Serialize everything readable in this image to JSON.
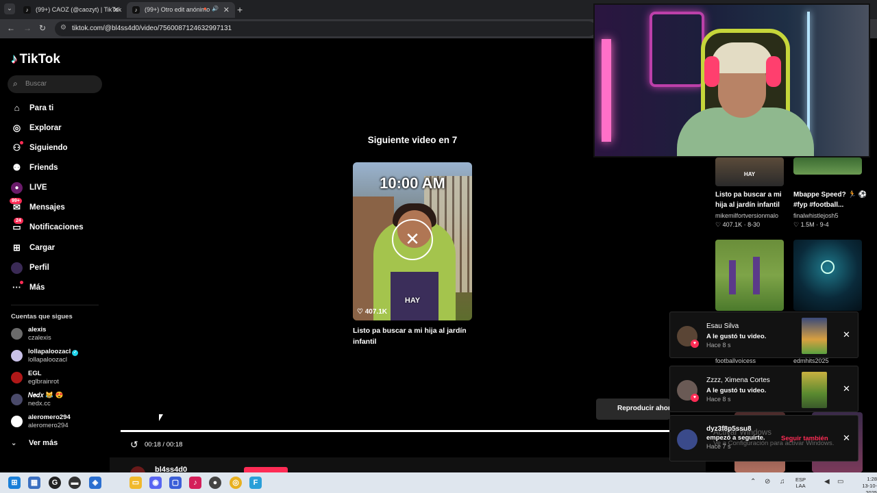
{
  "browser": {
    "tabs": [
      {
        "title": "(99+) CAOZ (@caozyt) | TikTok",
        "active": false
      },
      {
        "title": "(99+) Otro edit anónimo",
        "active": true
      }
    ],
    "url": "tiktok.com/@bl4ss4d0/video/7560087124632997131"
  },
  "sidebar": {
    "logo": "TikTok",
    "search_placeholder": "Buscar",
    "nav": [
      {
        "label": "Para ti",
        "icon": "home-icon"
      },
      {
        "label": "Explorar",
        "icon": "compass-icon"
      },
      {
        "label": "Siguiendo",
        "icon": "following-icon"
      },
      {
        "label": "Friends",
        "icon": "friends-icon"
      },
      {
        "label": "LIVE",
        "icon": "live-icon"
      },
      {
        "label": "Mensajes",
        "icon": "messages-icon",
        "badge": "99+"
      },
      {
        "label": "Notificaciones",
        "icon": "notifications-icon",
        "badge": "24"
      },
      {
        "label": "Cargar",
        "icon": "upload-icon"
      },
      {
        "label": "Perfil",
        "icon": "profile-icon"
      },
      {
        "label": "Más",
        "icon": "more-icon"
      }
    ],
    "following_title": "Cuentas que sigues",
    "following": [
      {
        "name": "alexis",
        "handle": "czalexis",
        "color": "#6b6b6b"
      },
      {
        "name": "lollapaloozacl",
        "handle": "lollapaloozacl",
        "verified": true,
        "color": "#c9c1e8"
      },
      {
        "name": "EGL",
        "handle": "eglbrainrot",
        "color": "#b01818"
      },
      {
        "name": "𝑁𝑒𝑑𝑥 😹 😍",
        "handle": "nedx.cc",
        "color": "#4a4a6a"
      },
      {
        "name": "aleromero294",
        "handle": "aleromero294",
        "color": "#ffffff"
      }
    ],
    "see_more": "Ver más"
  },
  "player": {
    "next_label": "Siguiente video en 7",
    "next_thumb_overlay_time": "10:00 AM",
    "next_thumb_overlay_hay": "HAY",
    "next_likes": "407.1K",
    "next_caption": "Listo pa buscar a mi hija al jardín infantil",
    "replay_now": "Reproducir ahora",
    "time": "00:18 / 00:18",
    "progress": 1.0,
    "author": "bl4ss4d0"
  },
  "grid": [
    {
      "title": "Listo pa buscar a mi hija al jardín infantil",
      "author": "mikemilfortversionmalo",
      "likes": "407.1K",
      "date": "8-30"
    },
    {
      "title": "Mbappe Speed? 🏃 ⚽#fyp #football...",
      "author": "finalwhistlejosh5",
      "likes": "1.5M",
      "date": "9-4"
    },
    {
      "author": "footballvoicess"
    },
    {
      "author": "edmhits2025"
    }
  ],
  "notifications": [
    {
      "name": "Esau Silva",
      "action": "A le gustó tu video.",
      "time": "Hace 8 s"
    },
    {
      "name": "Zzzz, Ximena Cortes",
      "action": "A le gustó tu video.",
      "time": "Hace 8 s"
    },
    {
      "name": "dyz3f8p5ssu8",
      "action": "empezó a seguirte.",
      "time": "Hace 7 s",
      "follow_back": "Seguir también"
    }
  ],
  "windows_watermark": {
    "title": "Activar Windows",
    "subtitle": "Ve a Configuración para activar Windows."
  },
  "taskbar": {
    "lang_top": "ESP",
    "lang_bottom": "LAA",
    "time": "1:28",
    "date": "13-10-2025"
  },
  "colors": {
    "accent": "#fe2c55",
    "verified": "#20d5ec"
  }
}
